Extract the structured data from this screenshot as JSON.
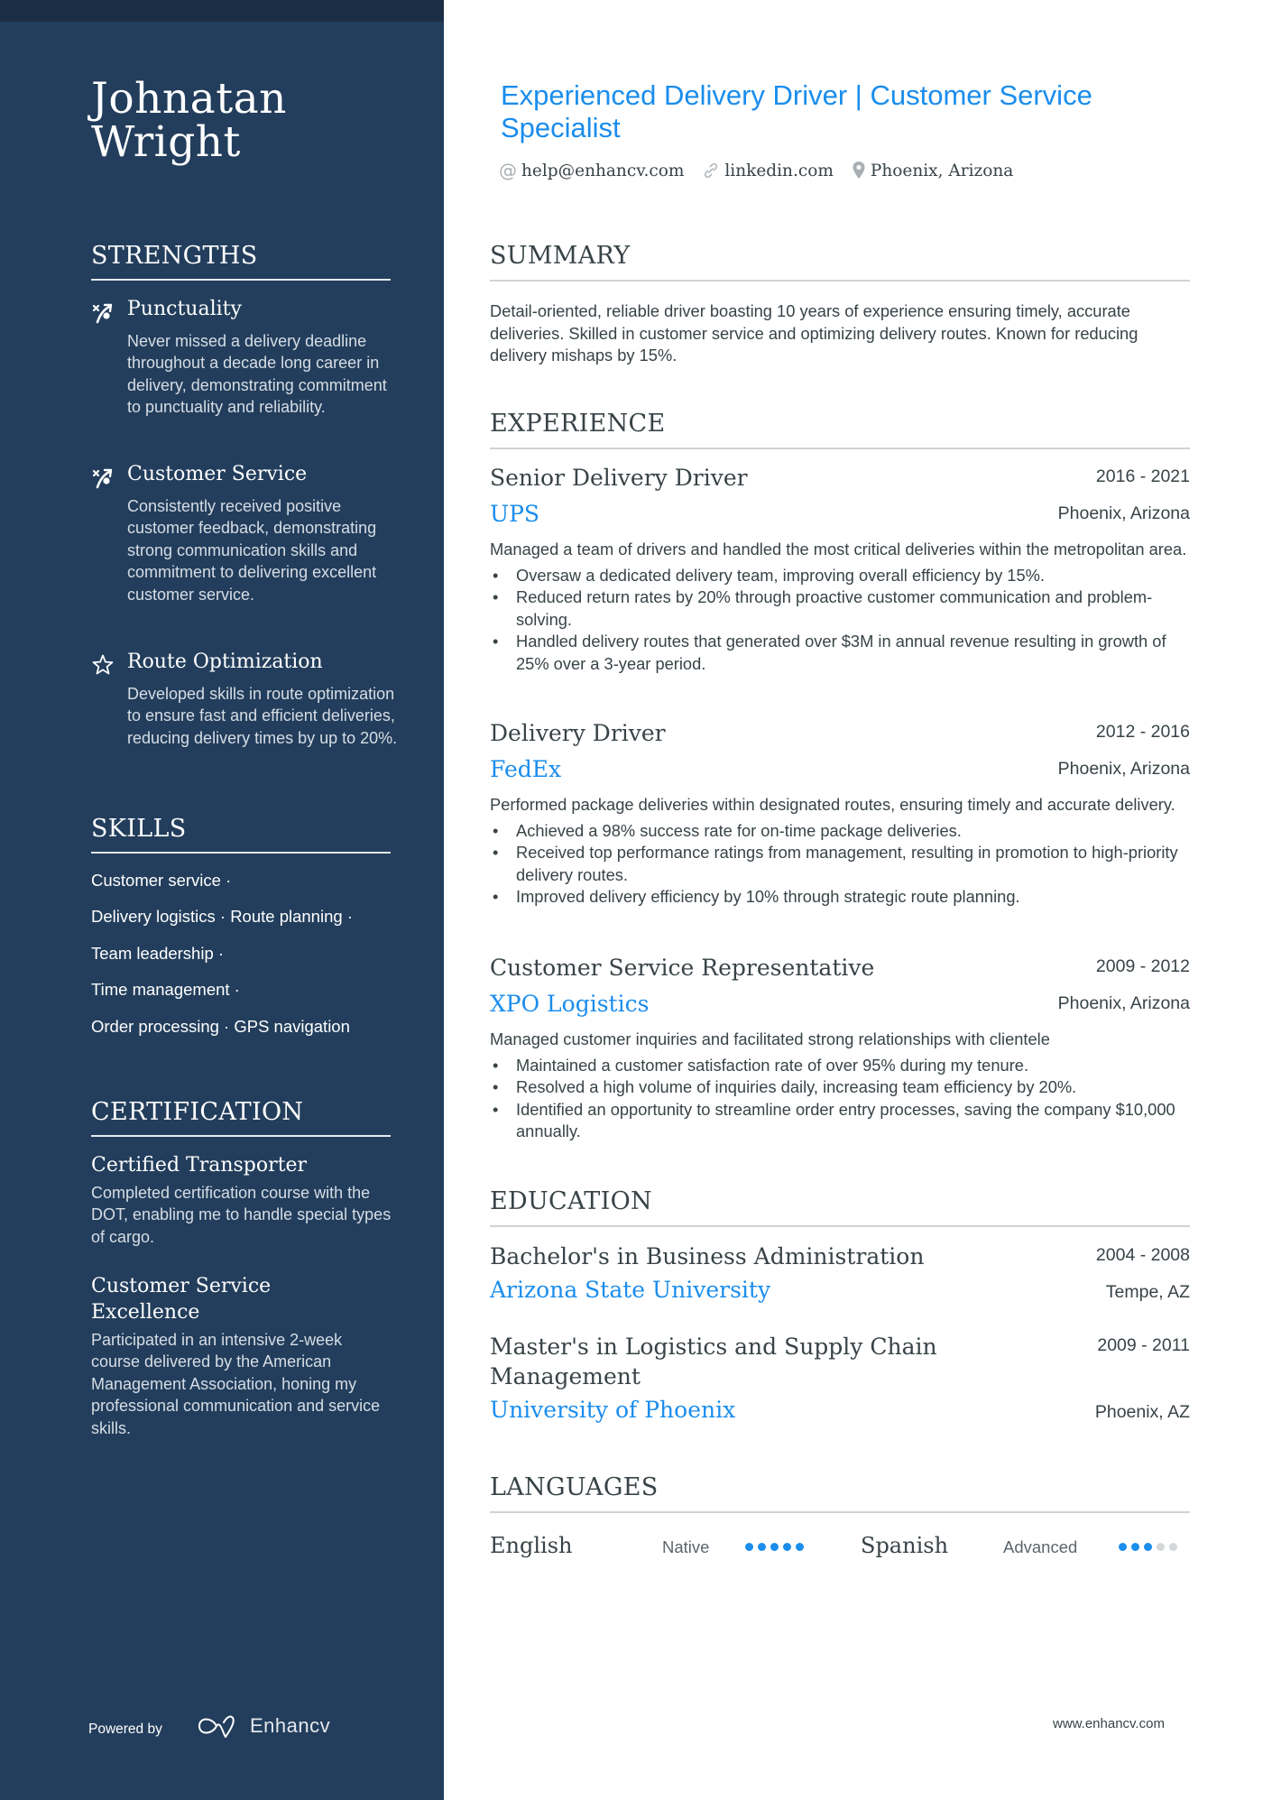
{
  "header": {
    "name_line1": "Johnatan",
    "name_line2": "Wright",
    "title": "Experienced Delivery Driver | Customer Service Specialist",
    "contacts": [
      {
        "icon": "at-icon",
        "text": "help@enhancv.com"
      },
      {
        "icon": "link-icon",
        "text": "linkedin.com"
      },
      {
        "icon": "location-pin-icon",
        "text": "Phoenix, Arizona"
      }
    ]
  },
  "sidebar": {
    "strengths": {
      "heading": "STRENGTHS",
      "items": [
        {
          "icon": "route-icon",
          "title": "Punctuality",
          "desc": "Never missed a delivery deadline throughout a decade long career in delivery, demonstrating commitment to punctuality and reliability."
        },
        {
          "icon": "route-icon",
          "title": "Customer Service",
          "desc": "Consistently received positive customer feedback, demonstrating strong communication skills and commitment to delivering excellent customer service."
        },
        {
          "icon": "star-icon",
          "title": "Route Optimization",
          "desc": "Developed skills in route optimization to ensure fast and efficient deliveries, reducing delivery times by up to 20%."
        }
      ]
    },
    "skills": {
      "heading": "SKILLS",
      "rows": [
        "Customer service ·",
        "Delivery logistics · Route planning ·",
        "Team leadership ·",
        "Time management ·",
        "Order processing · GPS navigation"
      ]
    },
    "certification": {
      "heading": "CERTIFICATION",
      "items": [
        {
          "title": "Certified Transporter",
          "desc": "Completed certification course with the DOT, enabling me to handle special types of cargo."
        },
        {
          "title": "Customer Service Excellence",
          "desc": "Participated in an intensive 2-week course delivered by the American Management Association, honing my professional communication and service skills."
        }
      ]
    },
    "footer": {
      "powered_by": "Powered by",
      "brand": "Enhancv"
    }
  },
  "summary": {
    "heading": "SUMMARY",
    "text": "Detail-oriented, reliable driver boasting 10 years of experience ensuring timely, accurate deliveries. Skilled in customer service and optimizing delivery routes. Known for reducing delivery mishaps by 15%."
  },
  "experience": {
    "heading": "EXPERIENCE",
    "jobs": [
      {
        "title": "Senior Delivery Driver",
        "dates": "2016 - 2021",
        "company": "UPS",
        "location": "Phoenix, Arizona",
        "desc": "Managed a team of drivers and handled the most critical deliveries within the metropolitan area.",
        "bullets": [
          "Oversaw a dedicated delivery team, improving overall efficiency by 15%.",
          "Reduced return rates by 20% through proactive customer communication and problem-solving.",
          "Handled delivery routes that generated over $3M in annual revenue resulting in growth of 25% over a 3-year period."
        ]
      },
      {
        "title": "Delivery Driver",
        "dates": "2012 - 2016",
        "company": "FedEx",
        "location": "Phoenix, Arizona",
        "desc": "Performed package deliveries within designated routes, ensuring timely and accurate delivery.",
        "bullets": [
          "Achieved a 98% success rate for on-time package deliveries.",
          "Received top performance ratings from management, resulting in promotion to high-priority delivery routes.",
          "Improved delivery efficiency by 10% through strategic route planning."
        ]
      },
      {
        "title": "Customer Service Representative",
        "dates": "2009 - 2012",
        "company": "XPO Logistics",
        "location": "Phoenix, Arizona",
        "desc": "Managed customer inquiries and facilitated strong relationships with clientele",
        "bullets": [
          "Maintained a customer satisfaction rate of over 95% during my tenure.",
          "Resolved a high volume of inquiries daily, increasing team efficiency by 20%.",
          "Identified an opportunity to streamline order entry processes, saving the company $10,000 annually."
        ]
      }
    ]
  },
  "education": {
    "heading": "EDUCATION",
    "items": [
      {
        "degree": "Bachelor's in Business Administration",
        "dates": "2004 - 2008",
        "school": "Arizona State University",
        "location": "Tempe, AZ"
      },
      {
        "degree": "Master's in Logistics and Supply Chain Management",
        "dates": "2009 - 2011",
        "school": "University of Phoenix",
        "location": "Phoenix, AZ"
      }
    ]
  },
  "languages": {
    "heading": "LANGUAGES",
    "items": [
      {
        "name": "English",
        "level": "Native",
        "rating": 5,
        "max": 5
      },
      {
        "name": "Spanish",
        "level": "Advanced",
        "rating": 3,
        "max": 5
      }
    ]
  },
  "footer": {
    "url": "www.enhancv.com"
  },
  "colors": {
    "sidebar_bg": "#233e5c",
    "sidebar_strip": "#1b2d44",
    "accent": "#1a8ded",
    "text": "#384347",
    "dot_off": "#d5d8da"
  }
}
